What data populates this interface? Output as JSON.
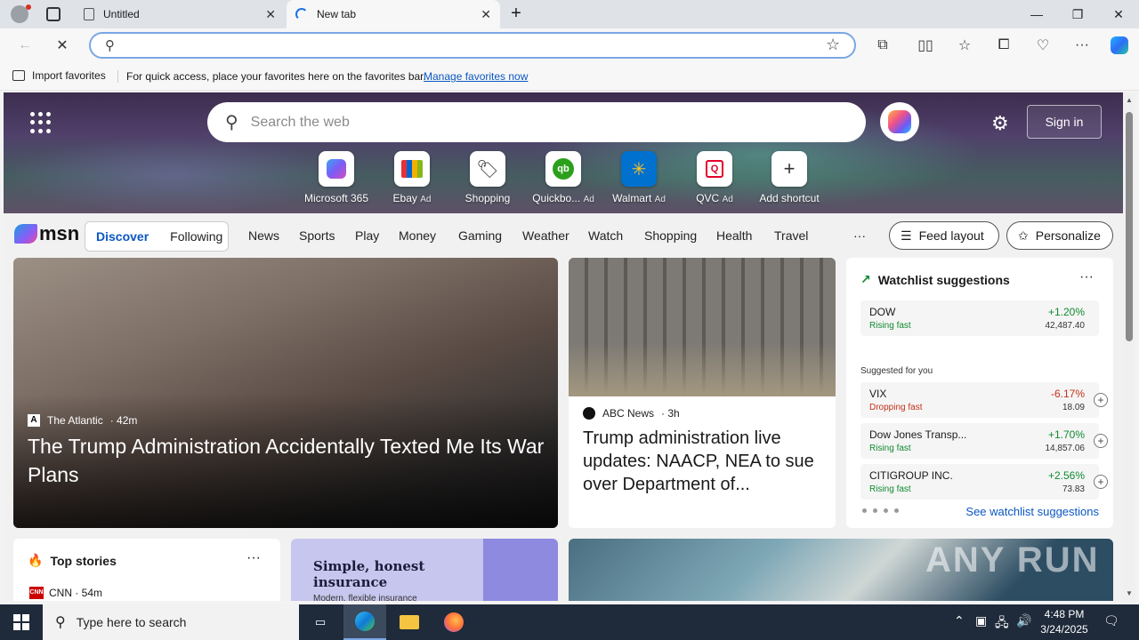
{
  "browser": {
    "tabs": [
      {
        "title": "Untitled"
      },
      {
        "title": "New tab"
      }
    ],
    "favorites_bar": {
      "import_label": "Import favorites",
      "hint": "For quick access, place your favorites here on the favorites bar.",
      "manage_link": "Manage favorites now"
    }
  },
  "newtab": {
    "search_placeholder": "Search the web",
    "sign_in": "Sign in",
    "shortcuts": [
      {
        "label": "Microsoft 365",
        "ad": ""
      },
      {
        "label": "Ebay",
        "ad": "Ad"
      },
      {
        "label": "Shopping",
        "ad": ""
      },
      {
        "label": "Quickbo...",
        "ad": "Ad"
      },
      {
        "label": "Walmart",
        "ad": "Ad"
      },
      {
        "label": "QVC",
        "ad": "Ad"
      },
      {
        "label": "Add shortcut",
        "ad": ""
      }
    ]
  },
  "msn": {
    "logo": "msn",
    "discover": "Discover",
    "following": "Following",
    "nav": [
      "News",
      "Sports",
      "Play",
      "Money",
      "Gaming",
      "Weather",
      "Watch",
      "Shopping",
      "Health",
      "Travel"
    ],
    "more": "···",
    "feed_layout": "Feed layout",
    "personalize": "Personalize"
  },
  "cards": {
    "hero": {
      "source": "The Atlantic",
      "time": "· 42m",
      "headline": "The Trump Administration Accidentally Texted Me Its War Plans"
    },
    "abc": {
      "source": "ABC News",
      "time": "· 3h",
      "headline": "Trump administration live updates: NAACP, NEA to sue over Department of..."
    },
    "watchlist": {
      "title": "Watchlist suggestions",
      "suggested_label": "Suggested for you",
      "see_all": "See watchlist suggestions",
      "stocks": [
        {
          "name": "DOW",
          "status": "Rising fast",
          "pct": "+1.20%",
          "value": "42,487.40",
          "dir": "up"
        },
        {
          "name": "VIX",
          "status": "Dropping fast",
          "pct": "-6.17%",
          "value": "18.09",
          "dir": "down"
        },
        {
          "name": "Dow Jones Transp...",
          "status": "Rising fast",
          "pct": "+1.70%",
          "value": "14,857.06",
          "dir": "up"
        },
        {
          "name": "CITIGROUP INC.",
          "status": "Rising fast",
          "pct": "+2.56%",
          "value": "73.83",
          "dir": "up"
        }
      ]
    },
    "top_stories": {
      "title": "Top stories",
      "source": "CNN · 54m"
    },
    "insurance_ad": {
      "title": "Simple, honest insurance",
      "subtitle": "Modern, flexible insurance"
    }
  },
  "watermark": "ANY RUN",
  "taskbar": {
    "search_placeholder": "Type here to search",
    "time": "4:48 PM",
    "date": "3/24/2025"
  },
  "colors": {
    "accent": "#0b57c2",
    "up": "#118a31",
    "down": "#c4321b"
  }
}
